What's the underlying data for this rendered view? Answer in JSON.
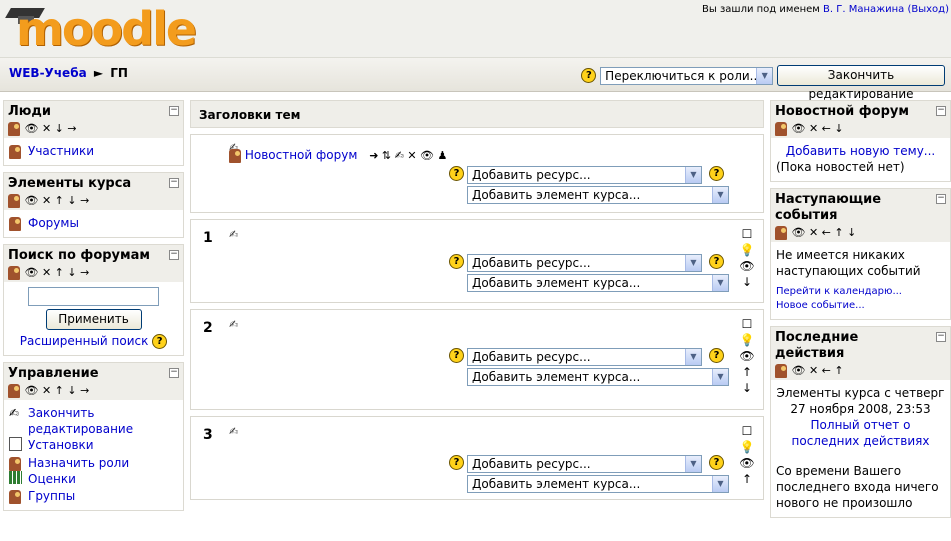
{
  "header": {
    "logo_text": "moodle",
    "login_prefix": "Вы зашли под именем",
    "user_name": "В. Г. Манажина",
    "logout_label": "(Выход)"
  },
  "navbar": {
    "crumbs": [
      "WEB-Учеба",
      "ГП"
    ],
    "crumb_sep": "►",
    "role_switch": "Переключиться к роли...",
    "finish_edit_button": "Закончить редактирование"
  },
  "icons": {
    "help": "?",
    "select_arrow": "▼",
    "collapse": "−",
    "block_ctrls_4": "👁 ✕ ↓ →",
    "block_ctrls_5": "👁 ✕ ↑ ↓ →",
    "right_ctrls_1": "👁 ✕ ← ↓",
    "right_ctrls_2": "👁 ✕ ← ↑ ↓",
    "right_ctrls_3": "👁 ✕ ← ↑",
    "pen": "✍",
    "forum_ctrls": "➜ ⇅ ✍ ✕ 👁 ♟",
    "section_tools_1": [
      "☐",
      "💡",
      "👁",
      "↓"
    ],
    "section_tools_2": [
      "☐",
      "💡",
      "👁",
      "↑",
      "↓"
    ],
    "section_tools_3": [
      "☐",
      "💡",
      "👁",
      "↑"
    ]
  },
  "left": {
    "people": {
      "title": "Люди",
      "items": [
        "Участники"
      ]
    },
    "activities": {
      "title": "Элементы курса",
      "items": [
        "Форумы"
      ]
    },
    "search": {
      "title": "Поиск по форумам",
      "button": "Применить",
      "advanced": "Расширенный поиск"
    },
    "admin": {
      "title": "Управление",
      "items": [
        "Закончить редактирование",
        "Установки",
        "Назначить роли",
        "Оценки",
        "Группы"
      ]
    }
  },
  "center": {
    "topics_title": "Заголовки тем",
    "news_forum": "Новостной форум",
    "add_resource": "Добавить ресурс...",
    "add_activity": "Добавить элемент курса...",
    "sections": [
      "1",
      "2",
      "3"
    ]
  },
  "right": {
    "news": {
      "title": "Новостной форум",
      "add_topic": "Добавить новую тему...",
      "no_news": "(Пока новостей нет)"
    },
    "events": {
      "title": "Наступающие события",
      "none": "Не имеется никаких наступающих событий",
      "calendar": "Перейти к календарю...",
      "new_event": "Новое событие..."
    },
    "recent": {
      "title": "Последние действия",
      "since": "Элементы курса с четверг 27 ноября 2008, 23:53",
      "full_report": "Полный отчет о последних действиях",
      "nothing": "Со времени Вашего последнего входа ничего нового не произошло"
    }
  }
}
